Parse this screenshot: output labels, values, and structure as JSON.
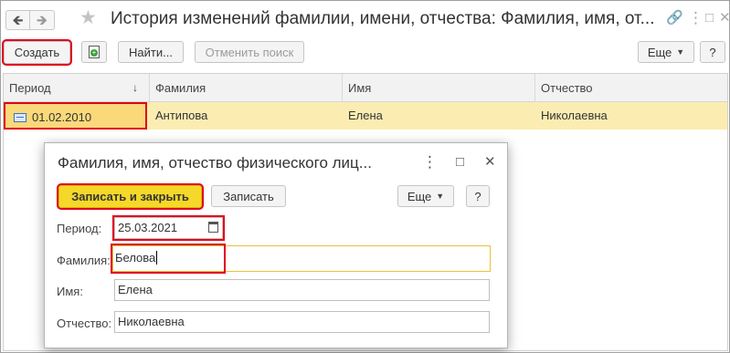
{
  "window": {
    "title": "История изменений фамилии, имени, отчества: Фамилия, имя, от...",
    "back_icon": "arrow-left-icon",
    "forward_icon": "arrow-right-icon",
    "favorite_icon": "star-icon"
  },
  "toolbar": {
    "create_label": "Создать",
    "find_label": "Найти...",
    "cancel_search_label": "Отменить поиск",
    "more_label": "Еще",
    "help_label": "?"
  },
  "table": {
    "columns": [
      "Период",
      "Фамилия",
      "Имя",
      "Отчество"
    ],
    "rows": [
      {
        "period": "01.02.2010",
        "surname": "Антипова",
        "name": "Елена",
        "patronymic": "Николаевна"
      }
    ]
  },
  "dialog": {
    "title": "Фамилия, имя, отчество физического лиц...",
    "save_close_label": "Записать и закрыть",
    "save_label": "Записать",
    "more_label": "Еще",
    "help_label": "?",
    "fields": {
      "period_label": "Период:",
      "period_value": "25.03.2021",
      "surname_label": "Фамилия:",
      "surname_value": "Белова",
      "name_label": "Имя:",
      "name_value": "Елена",
      "patronymic_label": "Отчество:",
      "patronymic_value": "Николаевна"
    }
  },
  "colors": {
    "accent_yellow": "#f5d829",
    "selected_row": "#fbedb2",
    "highlight_red": "#e0001b",
    "active_field_border": "#e8c23a"
  }
}
